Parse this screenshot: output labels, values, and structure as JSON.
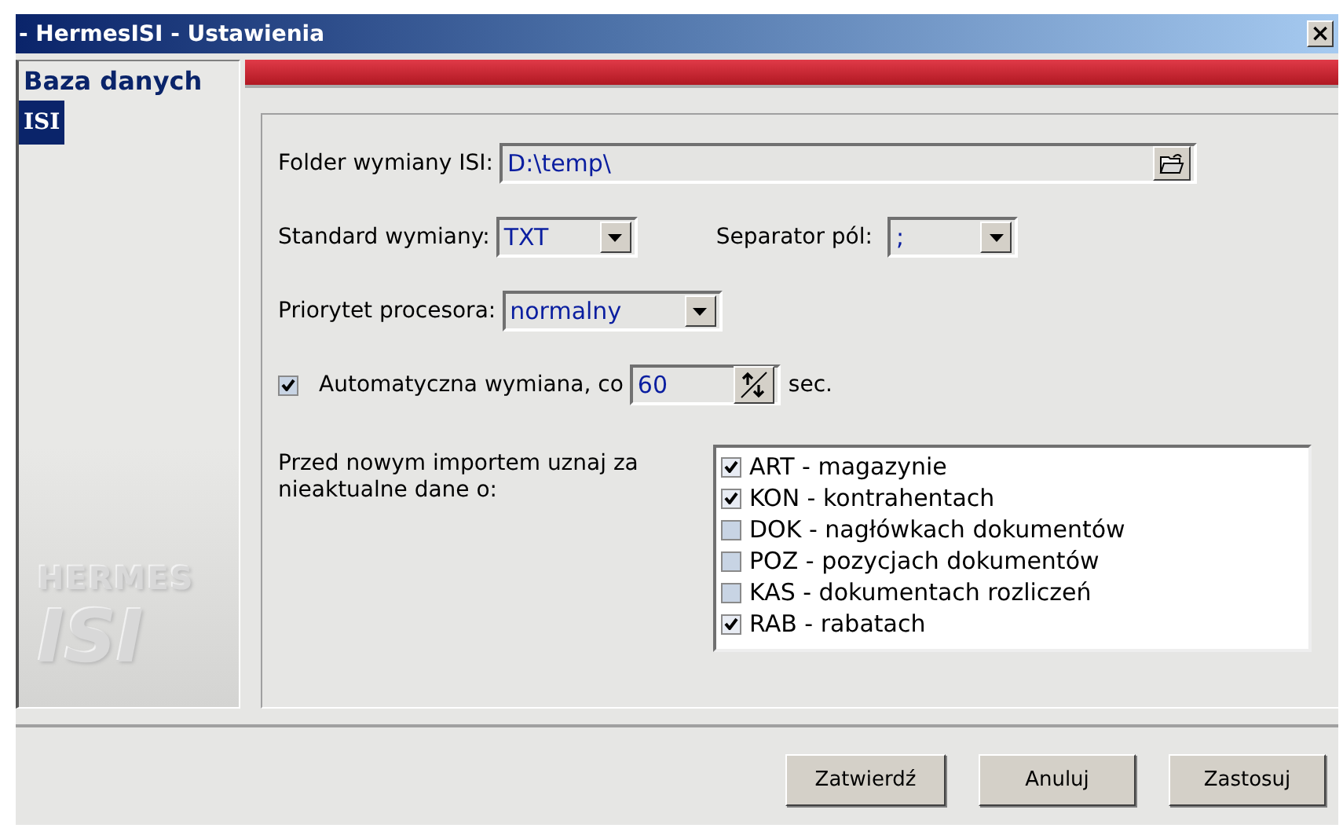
{
  "window": {
    "title": "- HermesISI - Ustawienia",
    "close": "×"
  },
  "sidebar": {
    "items": [
      {
        "label": "Baza danych",
        "selected": false
      },
      {
        "label": "ISI",
        "selected": true
      }
    ],
    "logo": {
      "line1": "HERMES",
      "line2": "ISI"
    }
  },
  "settings": {
    "folder": {
      "label": "Folder wymiany ISI:",
      "value": "D:\\temp\\"
    },
    "standard": {
      "label": "Standard wymiany:",
      "value": "TXT"
    },
    "separator": {
      "label": "Separator pól:",
      "value": ";"
    },
    "priority": {
      "label": "Priorytet procesora:",
      "value": "normalny"
    },
    "auto_exchange": {
      "label": "Automatyczna wymiana, co",
      "checked": true,
      "value": "60",
      "unit": "sec."
    },
    "outdated": {
      "label": "Przed nowym importem uznaj za nieaktualne dane o:",
      "items": [
        {
          "label": "ART - magazynie",
          "checked": true
        },
        {
          "label": "KON - kontrahentach",
          "checked": true
        },
        {
          "label": "DOK - nagłówkach dokumentów",
          "checked": false
        },
        {
          "label": "POZ - pozycjach dokumentów",
          "checked": false
        },
        {
          "label": "KAS - dokumentach rozliczeń",
          "checked": false
        },
        {
          "label": "RAB - rabatach",
          "checked": true
        }
      ]
    }
  },
  "buttons": [
    "Zatwierdź",
    "Anuluj",
    "Zastosuj"
  ]
}
